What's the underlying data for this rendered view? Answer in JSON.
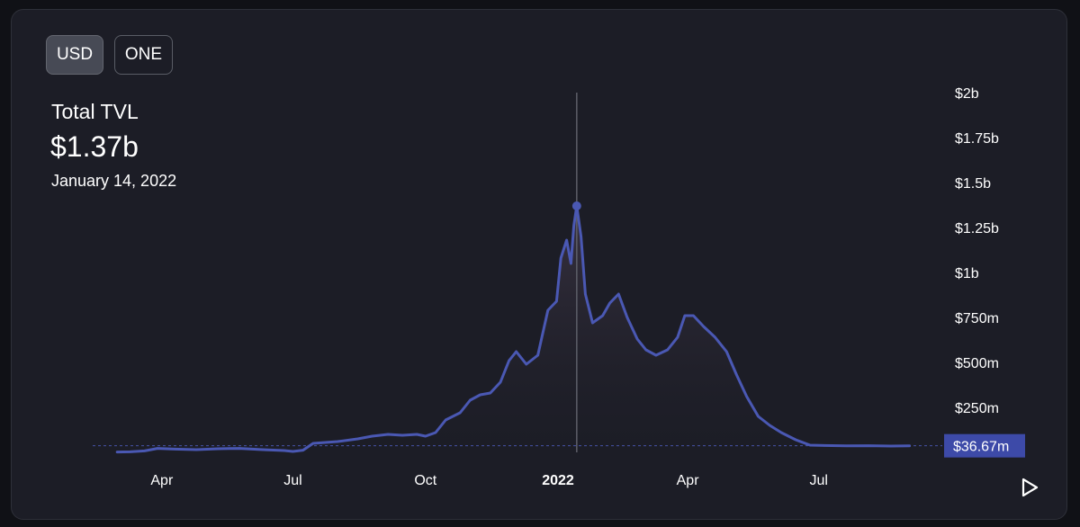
{
  "toggles": {
    "usd": "USD",
    "one": "ONE",
    "active": "USD"
  },
  "header": {
    "title": "Total TVL",
    "value": "$1.37b",
    "date": "January 14, 2022"
  },
  "colors": {
    "line": "#4a58b3",
    "fill_top": "#3a3342",
    "background": "#1c1d26",
    "current_badge": "#3d4aa8",
    "text": "#ffffff"
  },
  "icons": {
    "play": "play-icon"
  },
  "chart_data": {
    "type": "area",
    "title": "Total TVL",
    "xlabel": "",
    "ylabel": "",
    "x_tick_labels": [
      {
        "date": "2021-04-01",
        "label": "Apr",
        "bold": false
      },
      {
        "date": "2021-07-01",
        "label": "Jul",
        "bold": false
      },
      {
        "date": "2021-10-01",
        "label": "Oct",
        "bold": false
      },
      {
        "date": "2022-01-01",
        "label": "2022",
        "bold": true
      },
      {
        "date": "2022-04-01",
        "label": "Apr",
        "bold": false
      },
      {
        "date": "2022-07-01",
        "label": "Jul",
        "bold": false
      }
    ],
    "y_tick_labels": [
      {
        "value": 250000000,
        "label": "$250m"
      },
      {
        "value": 500000000,
        "label": "$500m"
      },
      {
        "value": 750000000,
        "label": "$750m"
      },
      {
        "value": 1000000000,
        "label": "$1b"
      },
      {
        "value": 1250000000,
        "label": "$1.25b"
      },
      {
        "value": 1500000000,
        "label": "$1.5b"
      },
      {
        "value": 1750000000,
        "label": "$1.75b"
      },
      {
        "value": 2000000000,
        "label": "$2b"
      }
    ],
    "ylim": [
      0,
      2000000000
    ],
    "xlim": [
      "2021-02-12",
      "2022-09-16"
    ],
    "current_value": {
      "value": 36670000,
      "label": "$36.67m"
    },
    "hover": {
      "date": "2022-01-14",
      "value": 1370000000
    },
    "series": [
      {
        "points": [
          [
            "2021-03-01",
            2000000
          ],
          [
            "2021-03-10",
            3000000
          ],
          [
            "2021-03-20",
            8000000
          ],
          [
            "2021-03-29",
            22000000
          ],
          [
            "2021-04-10",
            18000000
          ],
          [
            "2021-04-25",
            15000000
          ],
          [
            "2021-05-10",
            20000000
          ],
          [
            "2021-05-25",
            22000000
          ],
          [
            "2021-06-10",
            15000000
          ],
          [
            "2021-06-25",
            10000000
          ],
          [
            "2021-07-01",
            5000000
          ],
          [
            "2021-07-08",
            12000000
          ],
          [
            "2021-07-15",
            50000000
          ],
          [
            "2021-08-01",
            60000000
          ],
          [
            "2021-08-15",
            75000000
          ],
          [
            "2021-08-25",
            90000000
          ],
          [
            "2021-09-05",
            100000000
          ],
          [
            "2021-09-15",
            95000000
          ],
          [
            "2021-09-25",
            100000000
          ],
          [
            "2021-10-01",
            90000000
          ],
          [
            "2021-10-08",
            110000000
          ],
          [
            "2021-10-15",
            180000000
          ],
          [
            "2021-10-25",
            220000000
          ],
          [
            "2021-11-01",
            290000000
          ],
          [
            "2021-11-08",
            320000000
          ],
          [
            "2021-11-15",
            330000000
          ],
          [
            "2021-11-22",
            390000000
          ],
          [
            "2021-11-28",
            510000000
          ],
          [
            "2021-12-03",
            560000000
          ],
          [
            "2021-12-10",
            490000000
          ],
          [
            "2021-12-18",
            540000000
          ],
          [
            "2021-12-25",
            790000000
          ],
          [
            "2021-12-31",
            840000000
          ],
          [
            "2022-01-03",
            1080000000
          ],
          [
            "2022-01-07",
            1180000000
          ],
          [
            "2022-01-10",
            1050000000
          ],
          [
            "2022-01-12",
            1260000000
          ],
          [
            "2022-01-14",
            1370000000
          ],
          [
            "2022-01-17",
            1200000000
          ],
          [
            "2022-01-20",
            880000000
          ],
          [
            "2022-01-25",
            720000000
          ],
          [
            "2022-02-01",
            760000000
          ],
          [
            "2022-02-06",
            830000000
          ],
          [
            "2022-02-12",
            880000000
          ],
          [
            "2022-02-18",
            750000000
          ],
          [
            "2022-02-25",
            630000000
          ],
          [
            "2022-03-03",
            570000000
          ],
          [
            "2022-03-10",
            540000000
          ],
          [
            "2022-03-18",
            570000000
          ],
          [
            "2022-03-25",
            640000000
          ],
          [
            "2022-03-30",
            760000000
          ],
          [
            "2022-04-05",
            760000000
          ],
          [
            "2022-04-12",
            700000000
          ],
          [
            "2022-04-20",
            640000000
          ],
          [
            "2022-04-28",
            560000000
          ],
          [
            "2022-05-05",
            430000000
          ],
          [
            "2022-05-12",
            310000000
          ],
          [
            "2022-05-20",
            200000000
          ],
          [
            "2022-05-28",
            150000000
          ],
          [
            "2022-06-05",
            110000000
          ],
          [
            "2022-06-15",
            70000000
          ],
          [
            "2022-06-25",
            40000000
          ],
          [
            "2022-07-05",
            38000000
          ],
          [
            "2022-07-20",
            36000000
          ],
          [
            "2022-08-05",
            37000000
          ],
          [
            "2022-08-20",
            35000000
          ],
          [
            "2022-09-02",
            36670000
          ]
        ]
      }
    ]
  }
}
